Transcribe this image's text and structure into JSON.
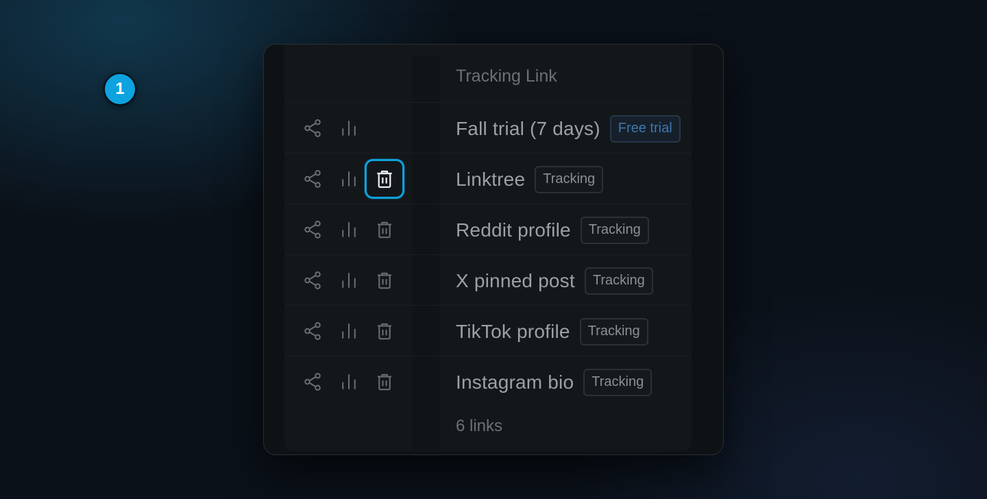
{
  "table": {
    "column_header": "Tracking Link",
    "rows": [
      {
        "name": "Fall trial (7 days)",
        "badge": "Free trial",
        "badge_type": "trial"
      },
      {
        "name": "Linktree",
        "badge": "Tracking",
        "badge_type": "tracking"
      },
      {
        "name": "Reddit profile",
        "badge": "Tracking",
        "badge_type": "tracking"
      },
      {
        "name": "X pinned post",
        "badge": "Tracking",
        "badge_type": "tracking"
      },
      {
        "name": "TikTok profile",
        "badge": "Tracking",
        "badge_type": "tracking"
      },
      {
        "name": "Instagram bio",
        "badge": "Tracking",
        "badge_type": "tracking"
      }
    ],
    "footer": "6 links"
  },
  "row_actions": [
    "share-icon",
    "bar-chart-icon",
    "trash-icon"
  ],
  "step_marker": "1",
  "colors": {
    "accent": "#0ea2de",
    "trial_badge": "#3f77ad",
    "text_muted": "#9ba1a7"
  }
}
